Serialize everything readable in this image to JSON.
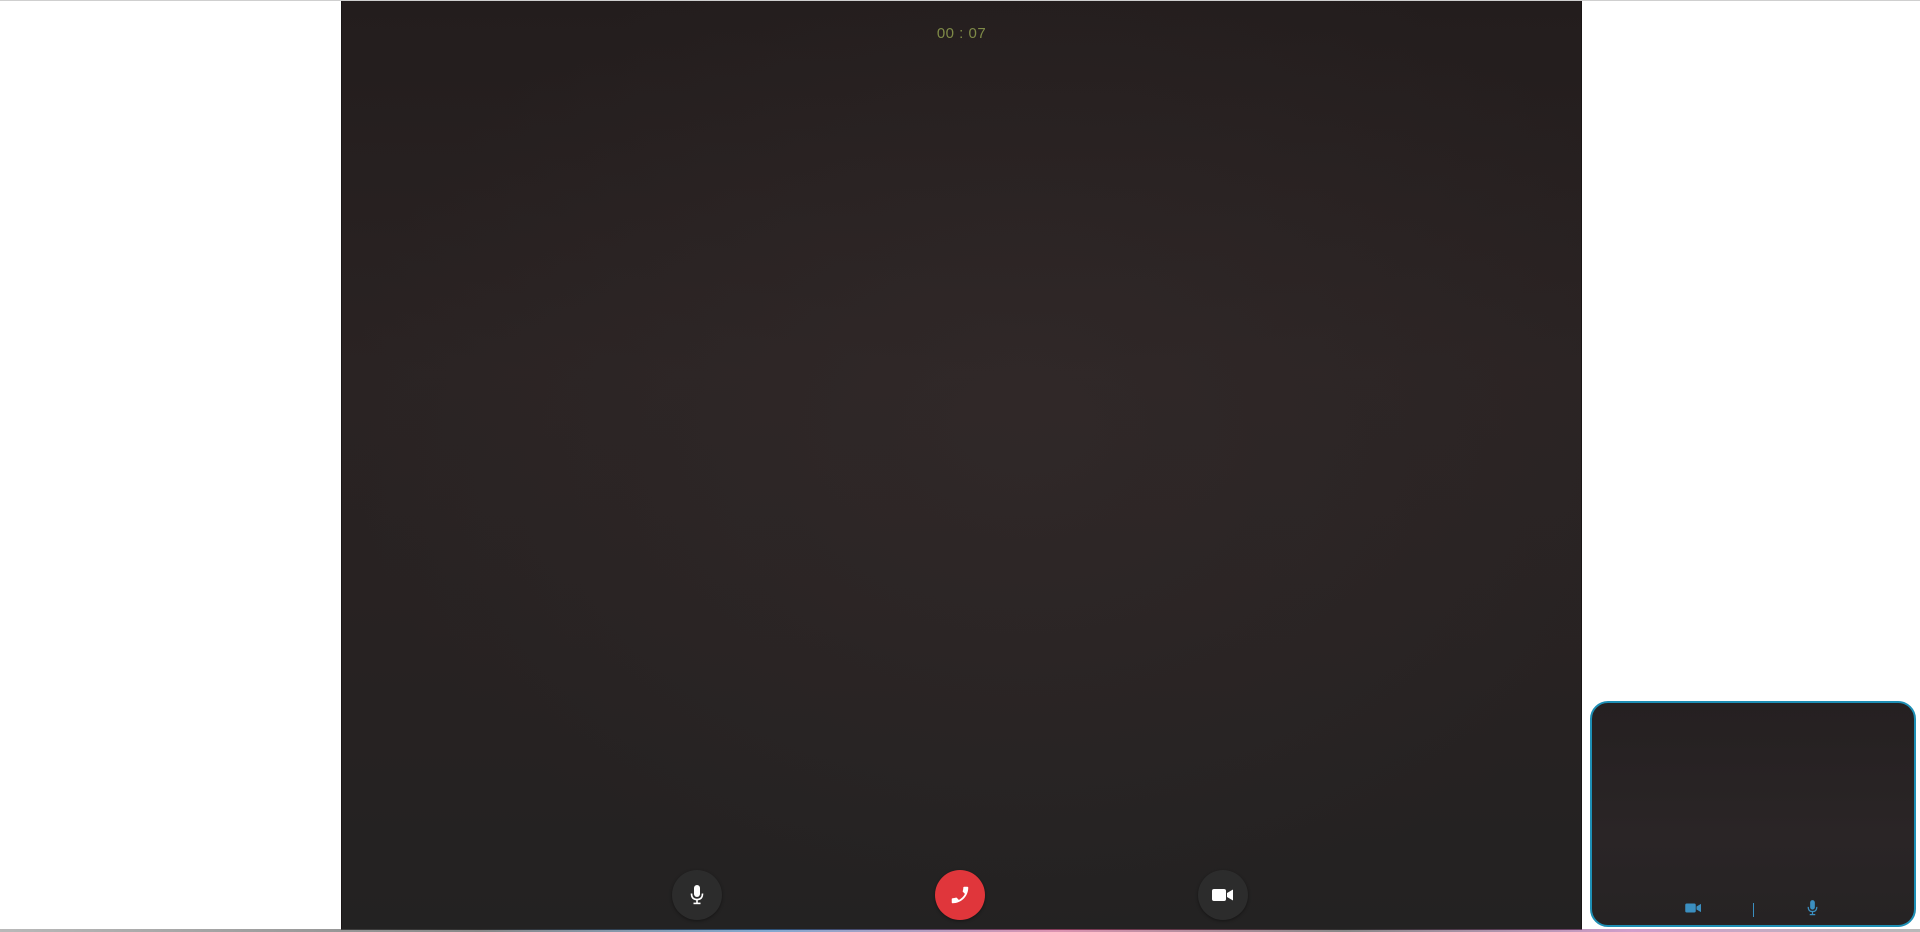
{
  "call": {
    "timer": "00 : 07"
  },
  "controls": {
    "mic_icon": "microphone-icon",
    "hangup_icon": "phone-icon",
    "video_icon": "video-camera-icon",
    "hangup_color": "#e0363b",
    "button_color": "#2c2c2c"
  },
  "self_view": {
    "border_color": "#1e8fb5",
    "camera_icon": "video-camera-icon",
    "mic_icon": "microphone-icon",
    "icon_color": "#3b8fc0"
  },
  "colors": {
    "timer": "#7f8a47",
    "video_bg": "#272222"
  }
}
